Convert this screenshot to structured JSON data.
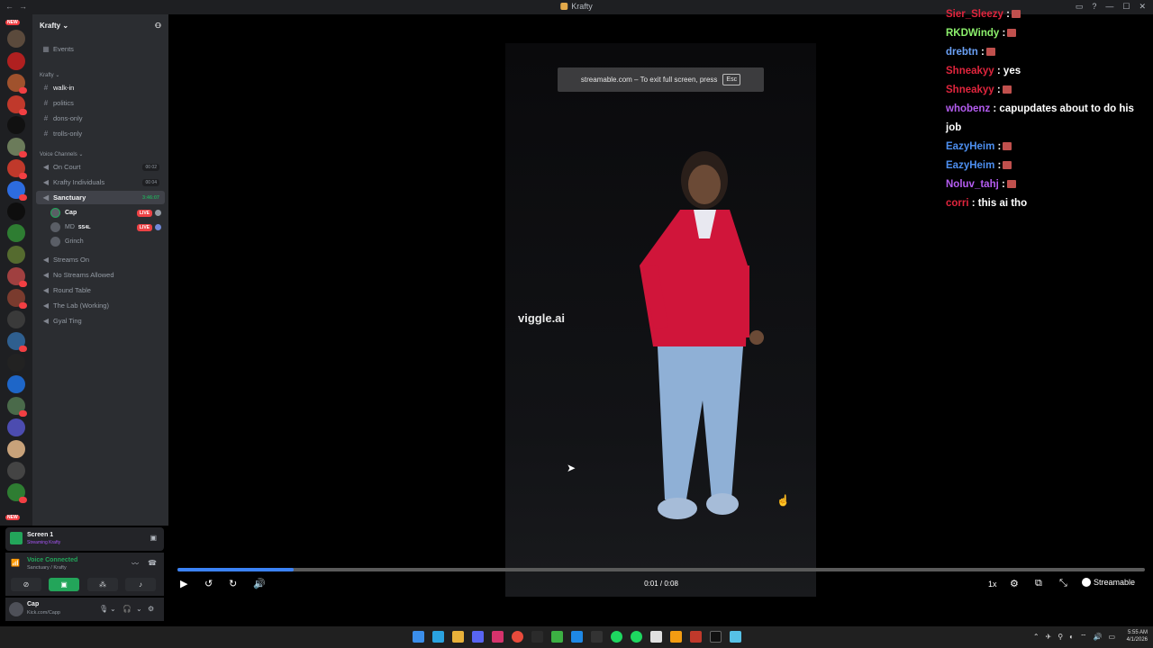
{
  "window": {
    "title": "Krafty"
  },
  "guild": {
    "name": "Krafty",
    "events": "Events",
    "category_text": "Krafty",
    "text_channels": [
      "walk-in",
      "politics",
      "dons-only",
      "trolls-only"
    ],
    "voice_category": "Voice Channels",
    "voice_channels": [
      {
        "name": "On Court",
        "count": "00 02"
      },
      {
        "name": "Krafty Individuals",
        "count": "00 04"
      },
      {
        "name": "Sanctuary",
        "time": "3:46:07"
      },
      {
        "name": "Streams On"
      },
      {
        "name": "No Streams Allowed"
      },
      {
        "name": "Round Table"
      },
      {
        "name": "The Lab (Working)"
      },
      {
        "name": "Gyal Ting"
      }
    ],
    "members": [
      {
        "name": "Cap",
        "live": "LIVE"
      },
      {
        "name": "MD",
        "tag": "SS4L",
        "live": "LIVE"
      },
      {
        "name": "Grinch"
      }
    ]
  },
  "screen_share": {
    "title": "Screen 1",
    "subtitle": "Streaming Krafty"
  },
  "voice": {
    "status": "Voice Connected",
    "location": "Sanctuary / Krafty"
  },
  "user": {
    "name": "Cap",
    "status": "Kick.com/Capp"
  },
  "rail": {
    "new": "NEW"
  },
  "video": {
    "toast_text": "streamable.com – To exit full screen, press",
    "toast_key": "Esc",
    "watermark": "viggle.ai",
    "time": "0:01 / 0:08",
    "progress": 0.12,
    "speed": "1x",
    "brand": "Streamable"
  },
  "chat": [
    {
      "user": "Sier_Sleezy",
      "color": "#e0253d",
      "text": ":",
      "emote": true
    },
    {
      "user": "RKDWindy",
      "color": "#8cf06c",
      "text": ":",
      "emote": true
    },
    {
      "user": "drebtn",
      "color": "#6aa0f5",
      "text": ":",
      "emote": true
    },
    {
      "user": "Shneakyy",
      "color": "#e0253d",
      "text": ": yes",
      "emote": false
    },
    {
      "user": "Shneakyy",
      "color": "#e0253d",
      "text": ":",
      "emote": true
    },
    {
      "user": "whobenz",
      "color": "#b45cf0",
      "text": ": capupdates about to do his job",
      "emote": false
    },
    {
      "user": "EazyHeim",
      "color": "#4d8ff0",
      "text": ":",
      "emote": true
    },
    {
      "user": "EazyHeim",
      "color": "#4d8ff0",
      "text": ":",
      "emote": true
    },
    {
      "user": "Noluv_tahj",
      "color": "#b45cf0",
      "text": ":",
      "emote": true
    },
    {
      "user": "corri",
      "color": "#e0253d",
      "text": ": this ai tho",
      "emote": false
    }
  ],
  "clock": {
    "time": "5:55 AM",
    "date": "4/1/2026"
  }
}
